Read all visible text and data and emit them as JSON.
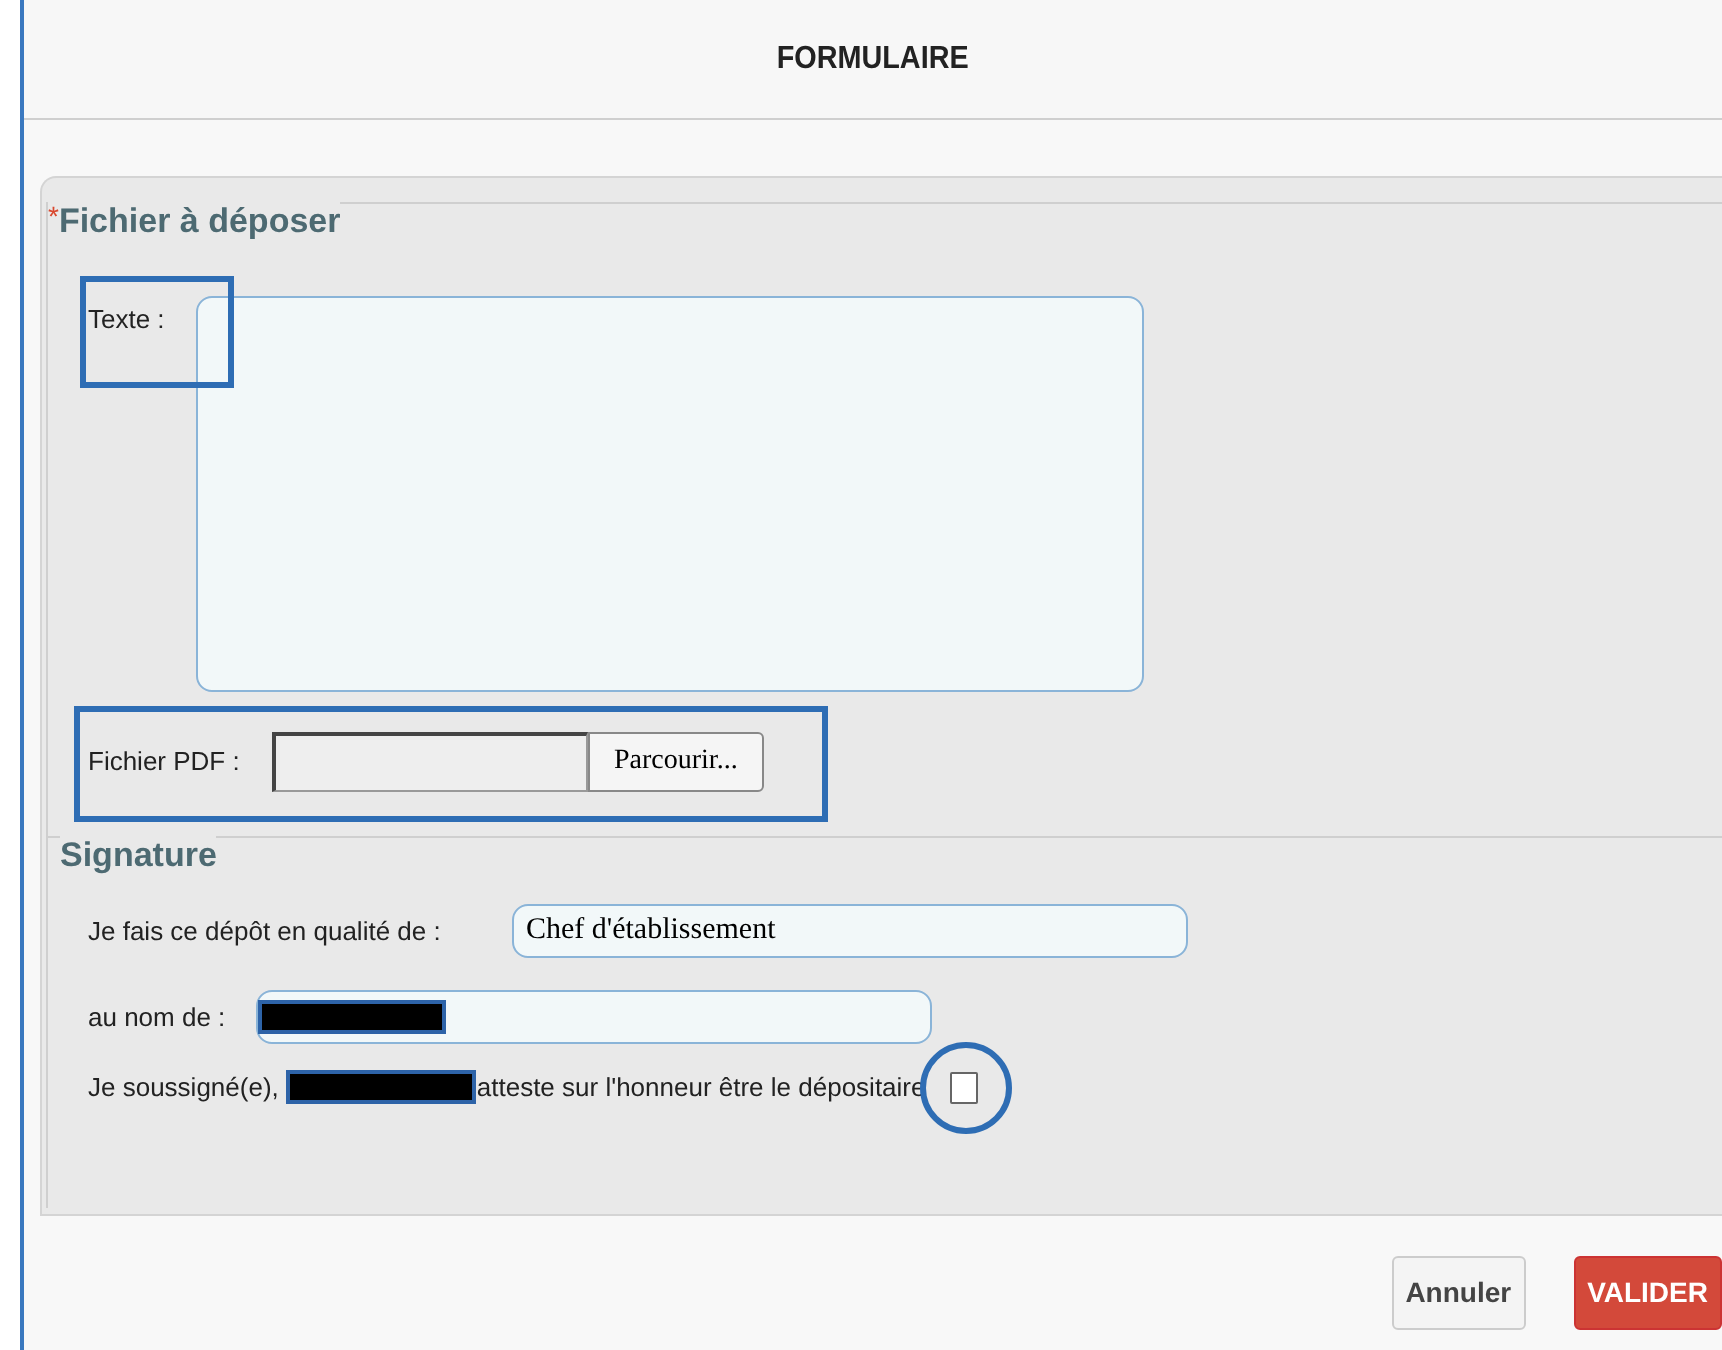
{
  "window": {
    "title": "FORMULAIRE"
  },
  "file_section": {
    "required_mark": "*",
    "legend": "Fichier à déposer",
    "text_label": "Texte :",
    "pdf_label": "Fichier PDF :",
    "browse_button": "Parcourir..."
  },
  "signature_section": {
    "legend": "Signature",
    "quality_label": "Je fais ce dépôt en qualité de :",
    "quality_value": "Chef d'établissement",
    "name_label": "au nom de :",
    "attest_before": "Je soussigné(e),",
    "attest_after": "atteste sur l'honneur être le dépositaire",
    "attest_checked": false
  },
  "buttons": [
    {
      "label": "Annuler",
      "kind": "cancel"
    },
    {
      "label": "VALIDER",
      "kind": "submit"
    }
  ]
}
